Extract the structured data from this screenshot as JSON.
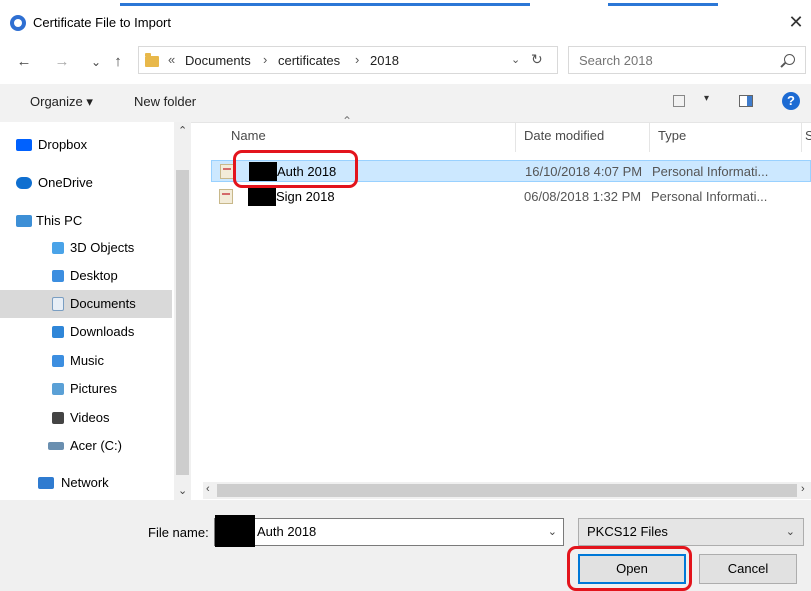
{
  "window": {
    "title": "Certificate File to Import",
    "close_glyph": "✕"
  },
  "nav": {
    "back_glyph": "←",
    "forward_glyph": "→",
    "recent_glyph": "⌄",
    "up_glyph": "↑"
  },
  "address": {
    "overflow": "«",
    "crumbs": [
      "Documents",
      "certificates",
      "2018"
    ],
    "separator": "›",
    "dropdown_glyph": "⌄",
    "refresh_glyph": "↻"
  },
  "search": {
    "placeholder": "Search 2018"
  },
  "toolbar": {
    "organize_label": "Organize ▾",
    "new_folder_label": "New folder",
    "view_drop_glyph": "▾",
    "help_glyph": "?"
  },
  "sidebar": {
    "items": [
      {
        "label": "Dropbox",
        "icon": "dropbox-icon",
        "color": "#0061fe"
      },
      {
        "label": "OneDrive",
        "icon": "onedrive-icon",
        "color": "#0f6fd0"
      },
      {
        "label": "This PC",
        "icon": "pc-icon",
        "color": "#3d8fd6"
      },
      {
        "label": "3D Objects",
        "icon": "3d-objects-icon",
        "color": "#4aa3e8"
      },
      {
        "label": "Desktop",
        "icon": "desktop-icon",
        "color": "#3c8ee0"
      },
      {
        "label": "Documents",
        "icon": "documents-icon",
        "color": "#7a9ec2",
        "selected": true
      },
      {
        "label": "Downloads",
        "icon": "downloads-icon",
        "color": "#2f86d8"
      },
      {
        "label": "Music",
        "icon": "music-icon",
        "color": "#3c8ee0"
      },
      {
        "label": "Pictures",
        "icon": "pictures-icon",
        "color": "#5aa0d6"
      },
      {
        "label": "Videos",
        "icon": "videos-icon",
        "color": "#444444"
      },
      {
        "label": "Acer (C:)",
        "icon": "drive-icon",
        "color": "#6a8fb0"
      },
      {
        "label": "Network",
        "icon": "network-icon",
        "color": "#2f7bd0"
      }
    ]
  },
  "columns": {
    "name": "Name",
    "date": "Date modified",
    "type": "Type",
    "size": "S"
  },
  "files": [
    {
      "name": "Auth 2018",
      "date": "16/10/2018 4:07 PM",
      "type": "Personal Informati...",
      "selected": true
    },
    {
      "name": "Sign 2018",
      "date": "06/08/2018 1:32 PM",
      "type": "Personal Informati..."
    }
  ],
  "bottom": {
    "filename_label": "File name:",
    "filename_value": "Auth 2018",
    "filetype_value": "PKCS12 Files",
    "open_label": "Open",
    "cancel_label": "Cancel"
  },
  "colors": {
    "accent": "#0078d7",
    "selection": "#cce8ff",
    "annotation": "#e3141c"
  }
}
